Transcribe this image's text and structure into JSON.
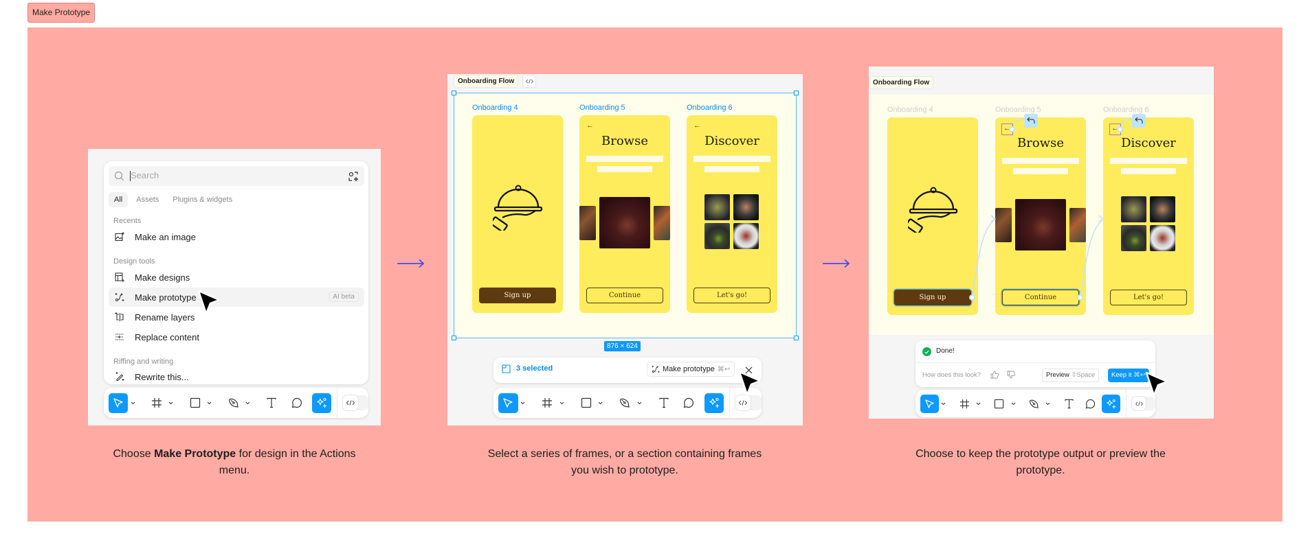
{
  "header": {
    "tag_label": "Make Prototype"
  },
  "colors": {
    "canvas_bg": "#ffaba3",
    "accent": "#0d99ff",
    "frame_yellow": "#ffec5c",
    "section_bg": "#fffdeb",
    "cta_brown": "#5e3a11",
    "flow_arrow": "#4a4af0",
    "success": "#14ae5c"
  },
  "step1": {
    "search_placeholder": "Search",
    "tabs": [
      "All",
      "Assets",
      "Plugins & widgets"
    ],
    "active_tab": "All",
    "sections": {
      "recents": "Recents",
      "design_tools": "Design tools",
      "riffing": "Riffing and writing"
    },
    "items": {
      "make_image": "Make an image",
      "make_designs": "Make designs",
      "make_prototype": "Make prototype",
      "make_prototype_badge": "AI beta",
      "rename_layers": "Rename layers",
      "replace_content": "Replace content",
      "rewrite": "Rewrite this..."
    },
    "caption_pre": "Choose ",
    "caption_bold": "Make Prototype",
    "caption_post": " for design in the Actions menu."
  },
  "step2": {
    "section_label": "Onboarding Flow",
    "frames": [
      {
        "label": "Onboarding 4",
        "title": "",
        "cta": "Sign up"
      },
      {
        "label": "Onboarding 5",
        "title": "Browse",
        "cta": "Continue"
      },
      {
        "label": "Onboarding 6",
        "title": "Discover",
        "cta": "Let's go!"
      }
    ],
    "dimensions": "876 × 624",
    "selected_count": "3 selected",
    "make_prototype_label": "Make prototype",
    "make_prototype_shortcut": "⌘↩",
    "caption": "Select a series of frames, or a section containing frames you wish to prototype."
  },
  "step3": {
    "section_label": "Onboarding Flow",
    "frames": [
      {
        "label": "Onboarding 4",
        "cta": "Sign up"
      },
      {
        "label": "Onboarding 5",
        "title": "Browse",
        "cta": "Continue"
      },
      {
        "label": "Onboarding 6",
        "title": "Discover",
        "cta": "Let's go!"
      }
    ],
    "status": "Done!",
    "feedback_question": "How does this look?",
    "preview_label": "Preview",
    "preview_shortcut": "⇧Space",
    "keep_label": "Keep it",
    "keep_shortcut": "⌘↩",
    "caption": "Choose to keep the prototype output or preview the prototype."
  },
  "toolbar_tools": [
    "move-tool",
    "frame-tool",
    "shape-tool",
    "pen-tool",
    "text-tool",
    "comment-tool",
    "actions-tool",
    "dev-mode-toggle"
  ]
}
